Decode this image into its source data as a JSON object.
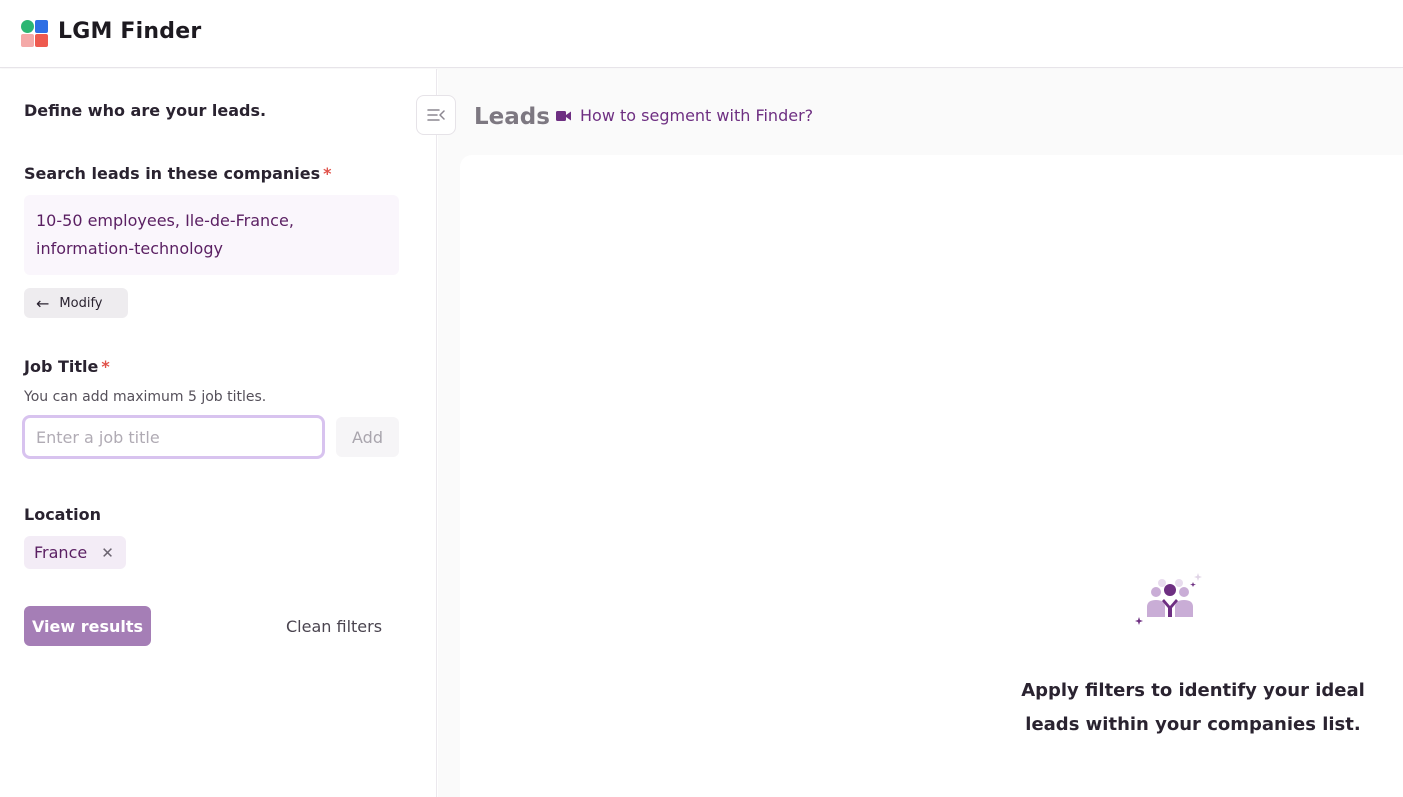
{
  "app": {
    "brand": "LGM Finder"
  },
  "sidebar": {
    "define_title": "Define who are your leads.",
    "companies": {
      "label": "Search leads in these companies",
      "required_mark": "*",
      "value": "10-50 employees, Ile-de-France, information-technology",
      "modify_label": "Modify"
    },
    "job_title": {
      "label": "Job Title",
      "required_mark": "*",
      "helper": "You can add maximum 5 job titles.",
      "placeholder": "Enter a job title",
      "add_label": "Add"
    },
    "location": {
      "label": "Location",
      "chips": [
        "France"
      ]
    },
    "view_results_label": "View results",
    "clean_filters_label": "Clean filters"
  },
  "main": {
    "title": "Leads",
    "howto_link": "How to segment with Finder?",
    "empty_state": "Apply filters to identify your ideal leads within your companies list."
  },
  "colors": {
    "accent": "#6e2f82",
    "primary_button": "#a57eb6",
    "required": "#e0524a",
    "chip_bg": "#f3ecf6"
  },
  "icons": {
    "logo": "lgm-logo-icon",
    "collapse": "collapse-sidebar-icon",
    "video": "video-camera-icon",
    "arrow": "arrow-left-icon",
    "remove": "close-icon",
    "empty": "people-group-icon"
  }
}
